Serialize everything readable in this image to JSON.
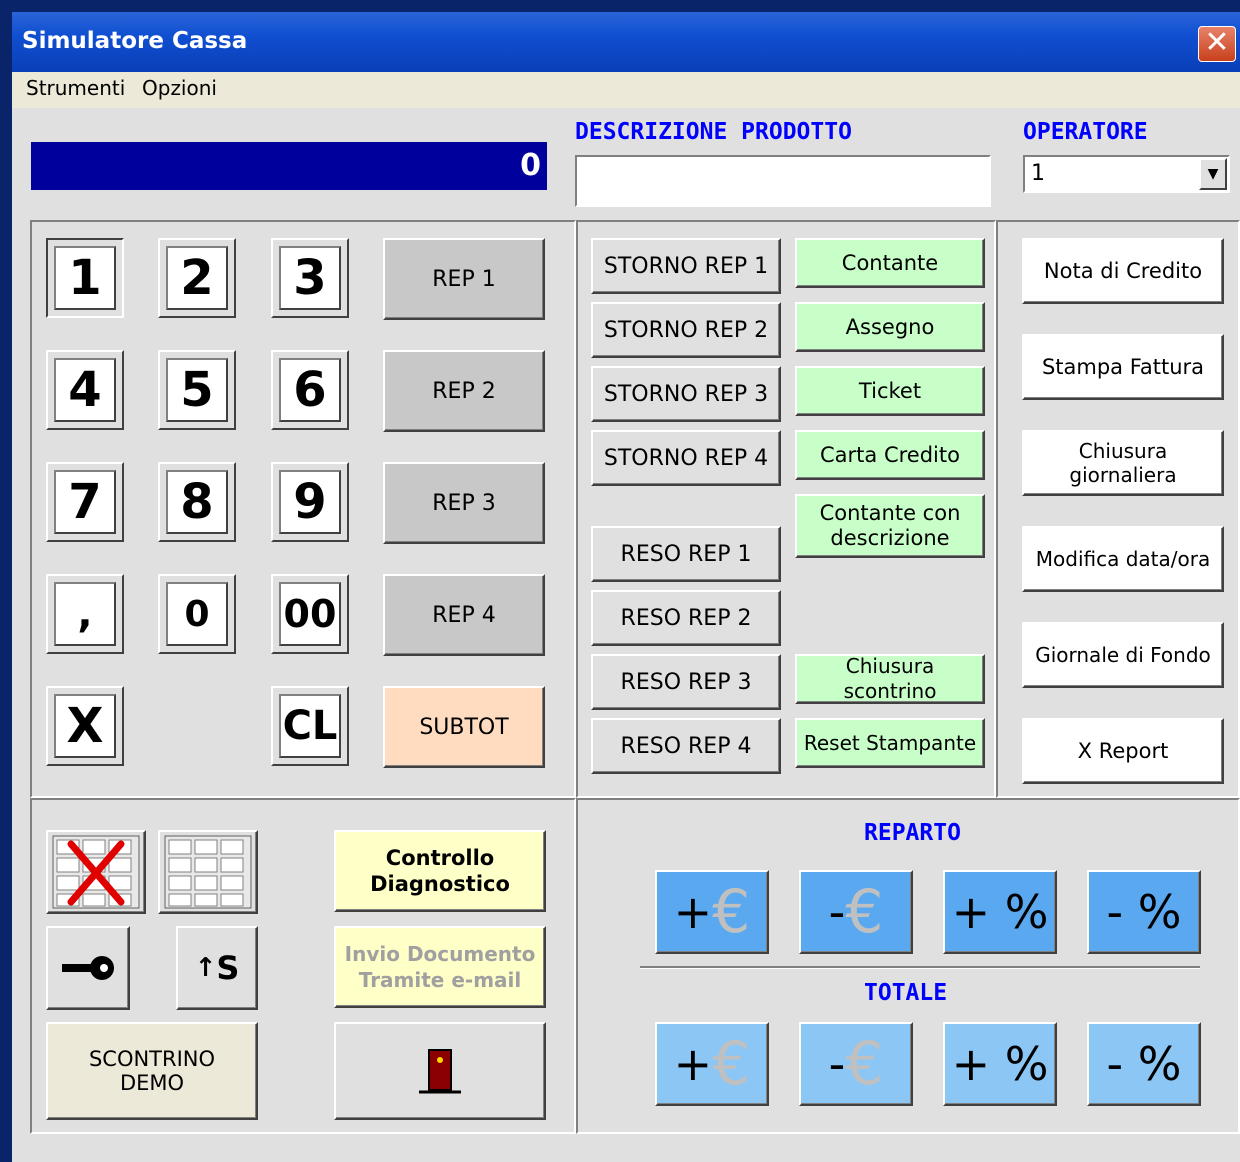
{
  "window": {
    "title": "Simulatore Cassa",
    "close": "✕"
  },
  "menu": {
    "items": [
      "Strumenti",
      "Opzioni"
    ]
  },
  "display": {
    "value": "0"
  },
  "description": {
    "label": "DESCRIZIONE PRODOTTO",
    "value": ""
  },
  "operator": {
    "label": "OPERATORE",
    "value": "1"
  },
  "keypad": {
    "keys": [
      "1",
      "2",
      "3",
      "4",
      "5",
      "6",
      "7",
      "8",
      "9",
      ",",
      "0",
      "00",
      "X",
      "CL"
    ],
    "rep": [
      "REP 1",
      "REP 2",
      "REP 3",
      "REP 4"
    ],
    "subtot": "SUBTOT"
  },
  "storno": [
    "STORNO REP 1",
    "STORNO REP 2",
    "STORNO REP 3",
    "STORNO REP 4"
  ],
  "reso": [
    "RESO REP 1",
    "RESO REP 2",
    "RESO REP 3",
    "RESO REP 4"
  ],
  "payments": [
    "Contante",
    "Assegno",
    "Ticket",
    "Carta Credito",
    "Contante con descrizione",
    "Chiusura scontrino",
    "Reset Stampante"
  ],
  "actions": [
    "Nota di Credito",
    "Stampa Fattura",
    "Chiusura giornaliera",
    "Modifica data/ora",
    "Giornale di Fondo",
    "X Report"
  ],
  "tools": {
    "diagnostic": "Controllo Diagnostico",
    "email": "Invio Documento Tramite e-mail",
    "demo": "SCONTRINO DEMO",
    "shift_s": "S"
  },
  "reparto": {
    "label": "REPARTO",
    "buttons": [
      "+",
      "-",
      "+ %",
      "- %"
    ]
  },
  "totale": {
    "label": "TOTALE",
    "buttons": [
      "+",
      "-",
      "+ %",
      "- %"
    ]
  },
  "colors": {
    "display_bg": "#00009c",
    "label_blue": "#0000ff",
    "green_btn": "#c8ffc8",
    "peach_btn": "#ffdcc0",
    "yellow_btn": "#ffffc8"
  }
}
